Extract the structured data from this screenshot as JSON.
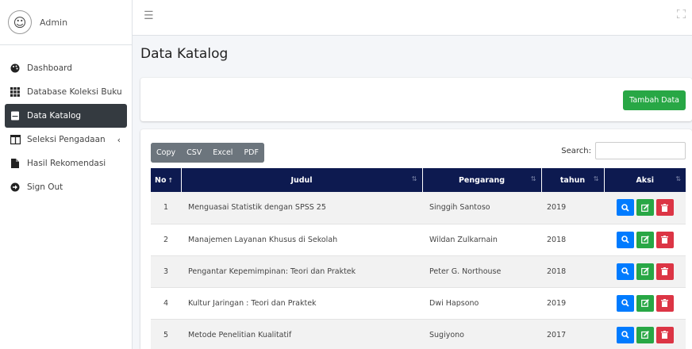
{
  "sidebar": {
    "user_name": "Admin",
    "items": [
      {
        "label": "Dashboard",
        "icon": "palette-icon"
      },
      {
        "label": "Database Koleksi Buku",
        "icon": "grid-icon"
      },
      {
        "label": "Data Katalog",
        "icon": "book-icon",
        "active": true
      },
      {
        "label": "Seleksi Pengadaan",
        "icon": "columns-icon",
        "chevron": "‹"
      },
      {
        "label": "Hasil Rekomendasi",
        "icon": "file-icon"
      },
      {
        "label": "Sign Out",
        "icon": "arrow-circle-icon"
      }
    ]
  },
  "page": {
    "title": "Data Katalog",
    "add_button": "Tambah Data"
  },
  "table_controls": {
    "export_buttons": [
      "Copy",
      "CSV",
      "Excel",
      "PDF"
    ],
    "search_label": "Search:",
    "search_value": ""
  },
  "table": {
    "headers": [
      "No",
      "Judul",
      "Pengarang",
      "tahun",
      "Aksi"
    ],
    "rows": [
      {
        "no": "1",
        "judul": "Menguasai Statistik dengan SPSS 25",
        "pengarang": "Singgih Santoso",
        "tahun": "2019"
      },
      {
        "no": "2",
        "judul": "Manajemen Layanan Khusus di Sekolah",
        "pengarang": "Wildan Zulkarnain",
        "tahun": "2018"
      },
      {
        "no": "3",
        "judul": "Pengantar Kepemimpinan: Teori dan Praktek",
        "pengarang": "Peter G. Northouse",
        "tahun": "2018"
      },
      {
        "no": "4",
        "judul": "Kultur Jaringan : Teori dan Praktek",
        "pengarang": "Dwi Hapsono",
        "tahun": "2019"
      },
      {
        "no": "5",
        "judul": "Metode Penelitian Kualitatif",
        "pengarang": "Sugiyono",
        "tahun": "2017"
      }
    ]
  },
  "colors": {
    "header_bg": "#0d1a50",
    "active_nav": "#343a40",
    "success": "#28a745",
    "primary": "#007bff",
    "danger": "#dc3545"
  }
}
